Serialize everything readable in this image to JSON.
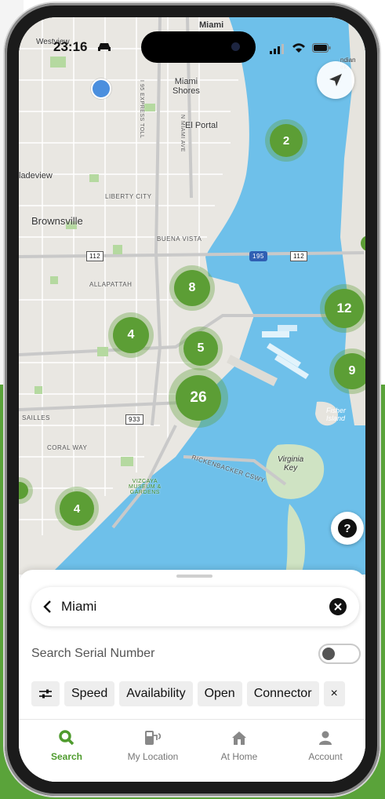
{
  "status_bar": {
    "time": "23:16"
  },
  "map": {
    "labels": {
      "miami_top": "Miami",
      "westview": "Westview",
      "miami_shores": "Miami\nShores",
      "el_portal": "El Portal",
      "gladeview": "ladeview",
      "liberty_city": "LIBERTY CITY",
      "brownsville": "Brownsville",
      "buena_vista": "BUENA VISTA",
      "allapattah": "ALLAPATTAH",
      "coral_way": "CORAL WAY",
      "versailles": "SAILLES",
      "vizcaya": "VIZCAYA\nMUSEUM &\nGARDENS",
      "rickenbacker": "RICKENBACKER CSWY",
      "virginia_key": "Virginia\nKey",
      "fisher_island": "Fisher\nIsland",
      "indian_creek": "ndian\nek",
      "i95_road": "I 95 EXPRESS TOLL",
      "miami_ave": "N MIAMI AVE",
      "shield_112": "112",
      "shield_195": "195",
      "shield_112b": "112",
      "shield_933": "933"
    },
    "clusters": [
      "2",
      "8",
      "4",
      "5",
      "12",
      "9",
      "26",
      "4"
    ],
    "help_label": "?"
  },
  "sheet": {
    "search_value": "Miami",
    "serial_label": "Search Serial Number",
    "serial_toggle_on": false,
    "filters": [
      "Speed",
      "Availability",
      "Open",
      "Connector"
    ],
    "more_filter": "×"
  },
  "tabs": [
    {
      "label": "Search",
      "icon": "search-icon",
      "active": true
    },
    {
      "label": "My Location",
      "icon": "charger-location-icon",
      "active": false
    },
    {
      "label": "At Home",
      "icon": "home-icon",
      "active": false
    },
    {
      "label": "Account",
      "icon": "account-icon",
      "active": false
    }
  ],
  "colors": {
    "accent": "#5aa33a",
    "cluster": "#5c9e35",
    "water": "#6ec0ea"
  }
}
